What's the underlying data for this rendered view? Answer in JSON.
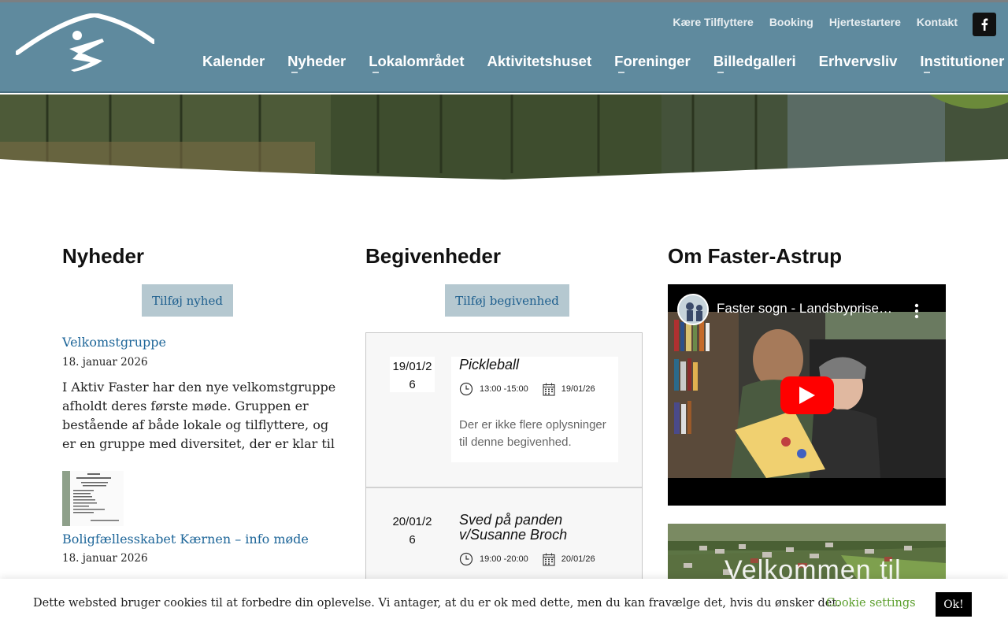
{
  "header": {
    "secondary_nav": [
      "Kære Tilflyttere",
      "Booking",
      "Hjertestartere",
      "Kontakt"
    ],
    "main_nav": [
      {
        "label": "Kalender",
        "has_submenu": false
      },
      {
        "label": "Nyheder",
        "has_submenu": true
      },
      {
        "label": "Lokalområdet",
        "has_submenu": true
      },
      {
        "label": "Aktivitetshuset",
        "has_submenu": false
      },
      {
        "label": "Foreninger",
        "has_submenu": true
      },
      {
        "label": "Billedgalleri",
        "has_submenu": true
      },
      {
        "label": "Erhvervsliv",
        "has_submenu": false
      },
      {
        "label": "Institutioner",
        "has_submenu": true
      }
    ],
    "social_icon": "facebook-icon",
    "header_color": "#5f8a9e"
  },
  "news": {
    "title": "Nyheder",
    "add_button": "Tilføj nyhed",
    "items": [
      {
        "title": "Velkomstgruppe",
        "date": "18. januar 2026",
        "excerpt": "I Aktiv Faster har den nye velkomstgruppe afholdt deres første møde. Gruppen er bestående af både lokale og tilflyttere, og er en gruppe med diversitet, der er klar til at"
      },
      {
        "title": "Boligfællesskabet Kærnen – info møde",
        "date": "18. januar 2026"
      }
    ]
  },
  "events": {
    "title": "Begivenheder",
    "add_button": "Tilføj begivenhed",
    "items": [
      {
        "date_line1": "19/01/2",
        "date_line2": "6",
        "title": "Pickleball",
        "time": "13:00 -15:00",
        "date": "19/01/26",
        "description": "Der er ikke flere oplysninger til denne begivenhed."
      },
      {
        "date_line1": "20/01/2",
        "date_line2": "6",
        "title": "Sved på panden v/Susanne Broch",
        "time": "19:00 -20:00",
        "date": "20/01/26"
      }
    ]
  },
  "about": {
    "title": "Om Faster-Astrup",
    "video_title": "Faster sogn - Landsbyprise…",
    "aerial_text": "Velkommen til"
  },
  "cookie": {
    "text": "Dette websted bruger cookies til at forbedre din oplevelse. Vi antager, at du er ok med dette, men du kan fravælge det, hvis du ønsker det.",
    "settings_label": "Cookie settings",
    "ok_label": "Ok!"
  }
}
